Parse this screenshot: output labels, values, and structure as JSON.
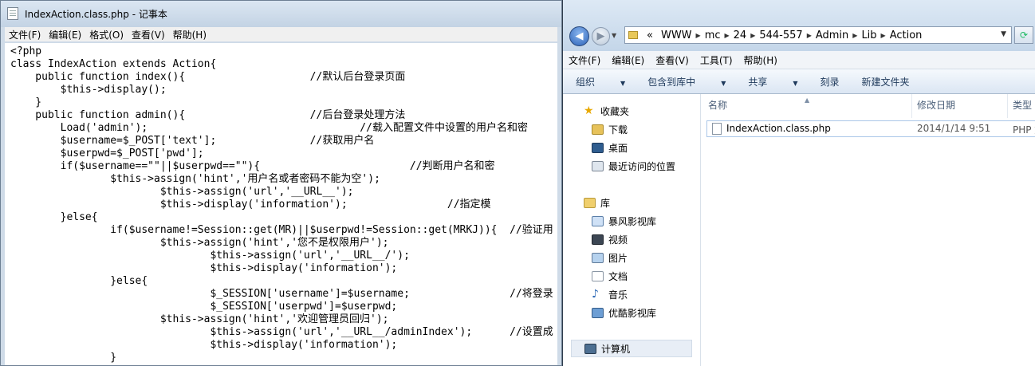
{
  "notepad": {
    "title": "IndexAction.class.php - 记事本",
    "menu": [
      "文件(F)",
      "编辑(E)",
      "格式(O)",
      "查看(V)",
      "帮助(H)"
    ],
    "code_lines": [
      "<?php",
      "class IndexAction extends Action{",
      "    public function index(){                    //默认后台登录页面",
      "        $this->display();",
      "    }",
      "    public function admin(){                    //后台登录处理方法",
      "        Load('admin');                                  //载入配置文件中设置的用户名和密",
      "        $username=$_POST['text'];               //获取用户名",
      "        $userpwd=$_POST['pwd'];",
      "        if($username==\"\"||$userpwd==\"\"){                        //判断用户名和密",
      "                $this->assign('hint','用户名或者密码不能为空');",
      "                        $this->assign('url','__URL__');",
      "                        $this->display('information');                //指定模",
      "        }else{",
      "                if($username!=Session::get(MR)||$userpwd!=Session::get(MRKJ)){  //验证用",
      "                        $this->assign('hint','您不是权限用户');",
      "                                $this->assign('url','__URL__/');",
      "                                $this->display('information');",
      "                }else{",
      "                                $_SESSION['username']=$username;                //将登录",
      "                                $_SESSION['userpwd']=$userpwd;",
      "                        $this->assign('hint','欢迎管理员回归');",
      "                                $this->assign('url','__URL__/adminIndex');      //设置成",
      "                                $this->display('information');",
      "                }",
      "        }"
    ]
  },
  "explorer": {
    "address": {
      "prefix": "«",
      "segments": [
        "WWW",
        "mc",
        "24",
        "544-557",
        "Admin",
        "Lib",
        "Action"
      ]
    },
    "menu": [
      "文件(F)",
      "编辑(E)",
      "查看(V)",
      "工具(T)",
      "帮助(H)"
    ],
    "toolbar": [
      {
        "label": "组织",
        "dropdown": true
      },
      {
        "label": "包含到库中",
        "dropdown": true
      },
      {
        "label": "共享",
        "dropdown": true
      },
      {
        "label": "刻录",
        "dropdown": false
      },
      {
        "label": "新建文件夹",
        "dropdown": false
      }
    ],
    "sidebar": {
      "favorites": {
        "label": "收藏夹",
        "items": [
          "下载",
          "桌面",
          "最近访问的位置"
        ]
      },
      "library": {
        "label": "库",
        "items": [
          "暴风影视库",
          "视频",
          "图片",
          "文档",
          "音乐",
          "优酷影视库"
        ]
      },
      "computer": "计算机"
    },
    "columns": [
      "名称",
      "修改日期",
      "类型"
    ],
    "files": [
      {
        "name": "IndexAction.class.php",
        "date": "2014/1/14 9:51",
        "type": "PHP 文"
      }
    ]
  }
}
